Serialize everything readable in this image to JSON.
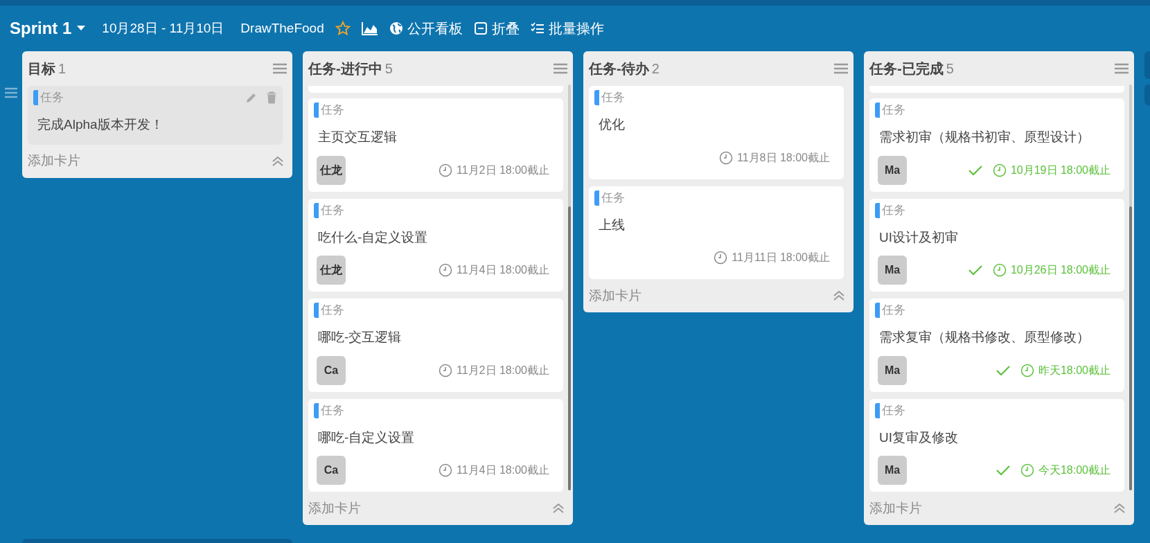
{
  "header": {
    "sprint": "Sprint 1",
    "dates": "10月28日 - 11月10日",
    "project": "DrawTheFood",
    "actions": [
      {
        "kind": "globe",
        "label": "公开看板"
      },
      {
        "kind": "collapse",
        "label": "折叠"
      },
      {
        "kind": "batch",
        "label": "批量操作"
      }
    ]
  },
  "columns": [
    {
      "title": "目标",
      "count": "1",
      "scrolled": false,
      "add_label": "添加卡片",
      "cards": [
        {
          "kind": "goal",
          "tag": "任务",
          "title": "完成Alpha版本开发！"
        }
      ]
    },
    {
      "title": "任务-进行中",
      "count": "5",
      "scrolled": true,
      "add_label": "添加卡片",
      "cards": [
        {
          "kind": "task",
          "tag": "任务",
          "title": "主页交互逻辑",
          "assignee": "仕龙",
          "due": "11月2日 18:00截止",
          "done": false
        },
        {
          "kind": "task",
          "tag": "任务",
          "title": "吃什么-自定义设置",
          "assignee": "仕龙",
          "due": "11月4日 18:00截止",
          "done": false
        },
        {
          "kind": "task",
          "tag": "任务",
          "title": "哪吃-交互逻辑",
          "assignee": "Ca",
          "due": "11月2日 18:00截止",
          "done": false
        },
        {
          "kind": "task",
          "tag": "任务",
          "title": "哪吃-自定义设置",
          "assignee": "Ca",
          "due": "11月4日 18:00截止",
          "done": false
        }
      ]
    },
    {
      "title": "任务-待办",
      "count": "2",
      "scrolled": false,
      "add_label": "添加卡片",
      "cards": [
        {
          "kind": "task",
          "tag": "任务",
          "title": "优化",
          "due": "11月8日 18:00截止",
          "done": false
        },
        {
          "kind": "task",
          "tag": "任务",
          "title": "上线",
          "due": "11月11日 18:00截止",
          "done": false
        }
      ]
    },
    {
      "title": "任务-已完成",
      "count": "5",
      "scrolled": true,
      "add_label": "添加卡片",
      "cards": [
        {
          "kind": "task",
          "tag": "任务",
          "title": "需求初审（规格书初审、原型设计）",
          "assignee": "Ma",
          "due": "10月19日 18:00截止",
          "done": true
        },
        {
          "kind": "task",
          "tag": "任务",
          "title": "UI设计及初审",
          "assignee": "Ma",
          "due": "10月26日 18:00截止",
          "done": true
        },
        {
          "kind": "task",
          "tag": "任务",
          "title": "需求复审（规格书修改、原型修改）",
          "assignee": "Ma",
          "due": "昨天18:00截止",
          "done": true
        },
        {
          "kind": "task",
          "tag": "任务",
          "title": "UI复审及修改",
          "assignee": "Ma",
          "due": "今天18:00截止",
          "done": true
        }
      ]
    }
  ]
}
